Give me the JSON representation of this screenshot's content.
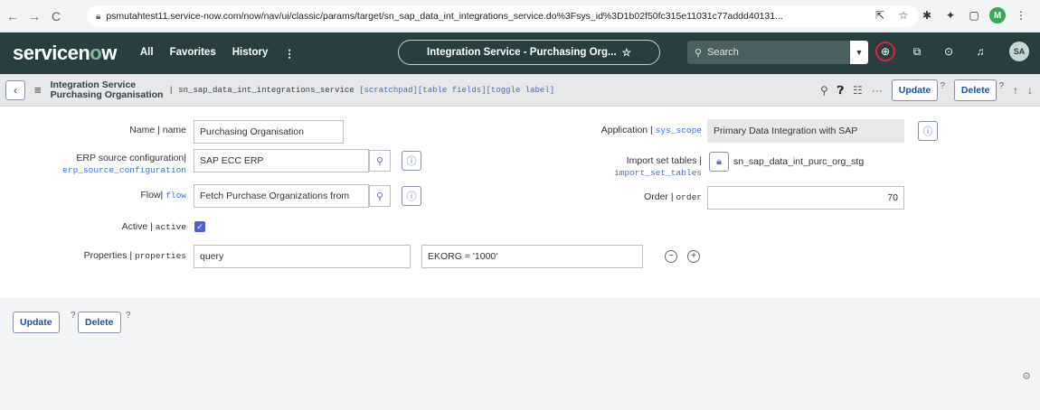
{
  "browser": {
    "url": "psmutahtest11.service-now.com/now/nav/ui/classic/params/target/sn_sap_data_int_integrations_service.do%3Fsys_id%3D1b02f50fc315e11031c77addd40131...",
    "back_icon": "arrow-left-icon",
    "forward_icon": "arrow-right-icon",
    "reload_icon": "reload-icon"
  },
  "banner": {
    "logo_text_a": "servicen",
    "logo_text_o": "o",
    "logo_text_b": "w",
    "nav": [
      "All",
      "Favorites",
      "History",
      "⋮"
    ],
    "record_title": "Integration Service - Purchasing Org...",
    "search_placeholder": "Search",
    "avatar": "SA"
  },
  "form_header": {
    "title_line1": "Integration Service",
    "title_line2": "Purchasing Organisation",
    "table_meta": "| sn_sap_data_int_integrations_service",
    "links": "[scratchpad][table fields][toggle label]",
    "update_label": "Update",
    "delete_label": "Delete",
    "help_mark": "?"
  },
  "fields": {
    "name": {
      "label": "Name",
      "api": "name",
      "value": "Purchasing Organisation"
    },
    "erp": {
      "label": "ERP source configuration",
      "api": "erp_source_configuration",
      "value": "SAP ECC ERP"
    },
    "flow": {
      "label": "Flow",
      "api": "flow",
      "value": "Fetch Purchase Organizations from"
    },
    "active": {
      "label": "Active",
      "api": "active",
      "checked": true
    },
    "properties": {
      "label": "Properties",
      "api": "properties",
      "key": "query",
      "value": "EKORG = '1000'"
    },
    "application": {
      "label": "Application",
      "api": "sys_scope",
      "value": "Primary Data Integration with SAP"
    },
    "import_set": {
      "label": "Import set tables",
      "api": "import_set_tables",
      "value": "sn_sap_data_int_purc_org_stg"
    },
    "order": {
      "label": "Order",
      "api": "order",
      "value": "70"
    }
  },
  "footer": {
    "update_label": "Update",
    "delete_label": "Delete",
    "help_mark": "?"
  }
}
